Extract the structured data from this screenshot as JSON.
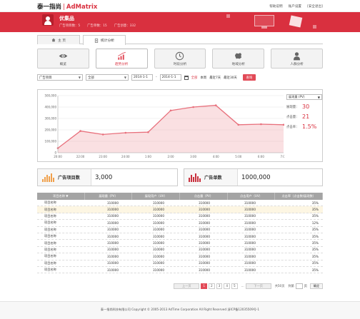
{
  "header": {
    "logo_cn": "泰一指尚",
    "logo_sep": "|",
    "logo_en": "AdMatrix",
    "links": [
      "帮助说明",
      "账户设置",
      "[安全退出]"
    ]
  },
  "user": {
    "name": "优集品",
    "ad_projects": "广告项目数：5",
    "ad_units": "广告单数：15",
    "ad_creatives": "广告创意：332"
  },
  "tabs": [
    {
      "label": "主 页",
      "icon": "home-icon"
    },
    {
      "label": "统计分析",
      "icon": "doc-icon"
    }
  ],
  "nav": [
    {
      "label": "概览",
      "icon": "eye-icon",
      "active": false
    },
    {
      "label": "趋势分析",
      "icon": "bar-trend-icon",
      "active": true
    },
    {
      "label": "时段分析",
      "icon": "clock-icon",
      "active": false
    },
    {
      "label": "地域分析",
      "icon": "map-icon",
      "active": false
    },
    {
      "label": "人群分析",
      "icon": "person-icon",
      "active": false
    }
  ],
  "filters": {
    "project_select": "广告项目",
    "scope_select": "全部",
    "date_from": "2014-1-1",
    "date_to": "2014-1-1",
    "quick": [
      "全部",
      "本周",
      "最近7天",
      "最近30天"
    ],
    "query": "查询"
  },
  "chart_data": {
    "type": "area",
    "x": [
      "20:00",
      "22:00",
      "23:00",
      "24:00",
      "1:00",
      "2:00",
      "3:00",
      "4:00",
      "5:00",
      "6:00",
      "7:00"
    ],
    "series": [
      {
        "values": [
          40000,
          190000,
          160000,
          175000,
          180000,
          370000,
          400000,
          415000,
          245000,
          250000,
          245000
        ]
      }
    ],
    "yticks": [
      "500,000",
      "400,000",
      "300,000",
      "200,000",
      "100,000",
      "0"
    ],
    "ylim": [
      0,
      500000
    ],
    "grid": true,
    "color": "#e8707c"
  },
  "legend": {
    "select": "展现量 (PV)",
    "items": [
      {
        "label": "展现量：",
        "value": "30"
      },
      {
        "label": "点击量：",
        "value": "21"
      },
      {
        "label": "点击率：",
        "value": "1.5%"
      }
    ]
  },
  "kpi": [
    {
      "label": "广告项目数",
      "value": "3,000",
      "icon": "bar-chart-icon"
    },
    {
      "label": "广告单数",
      "value": "1000,000",
      "icon": "bar-chart-icon"
    }
  ],
  "table": {
    "columns": [
      "项目名称 ▼",
      "展现量（PV）",
      "展现用户（UV）",
      "点击量（PV）",
      "点击用户（UV）",
      "点击率（点击数/展现数）"
    ],
    "rows": [
      [
        "项目名称",
        "310000",
        "310000",
        "310000",
        "310000",
        "35%"
      ],
      [
        "项目名称",
        "310000",
        "310000",
        "310000",
        "310000",
        "35%"
      ],
      [
        "项目名称",
        "310000",
        "310000",
        "310000",
        "310000",
        "35%"
      ],
      [
        "项目名称",
        "310000",
        "310000",
        "310000",
        "310000",
        "12%"
      ],
      [
        "项目名称",
        "310000",
        "310000",
        "310000",
        "310000",
        "35%"
      ],
      [
        "项目名称",
        "310000",
        "310000",
        "310000",
        "310000",
        "35%"
      ],
      [
        "项目名称",
        "310000",
        "310000",
        "310000",
        "310000",
        "35%"
      ],
      [
        "项目名称",
        "310000",
        "310000",
        "310000",
        "310000",
        "35%"
      ],
      [
        "项目名称",
        "310000",
        "310000",
        "310000",
        "310000",
        "35%"
      ],
      [
        "项目名称",
        "310000",
        "310000",
        "310000",
        "310000",
        "35%"
      ],
      [
        "项目名称",
        "310000",
        "310000",
        "310000",
        "310000",
        "35%"
      ]
    ],
    "highlight_row": 1
  },
  "pager": {
    "prev": "上一页",
    "pages": [
      "1",
      "2",
      "3",
      "4",
      "5"
    ],
    "current": "1",
    "ellipsis": "...",
    "next": "下一页",
    "total": "共50页",
    "goto": "到第",
    "page_unit": "页",
    "ok": "确定"
  },
  "footer": {
    "text": "泰一指尚科技有限公司 Copyright © 2005-2013 AdTime Corporation All Right Reserved 浙ICP备12035509号-1"
  }
}
